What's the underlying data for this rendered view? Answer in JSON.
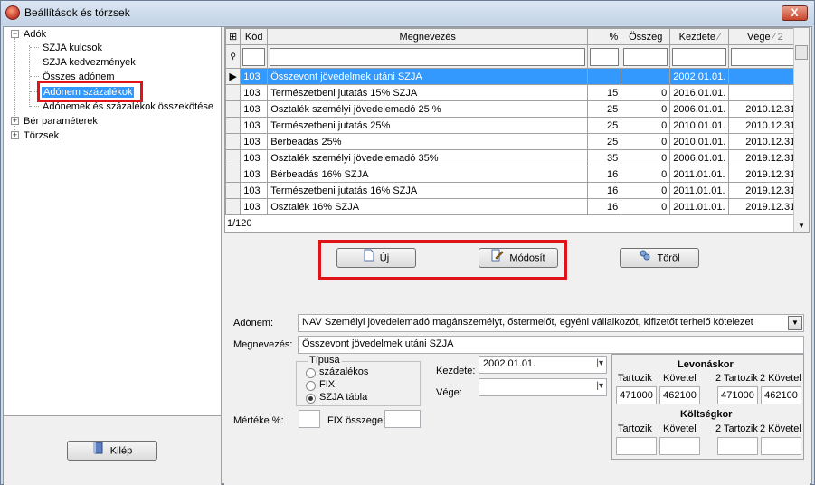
{
  "window": {
    "title": "Beállítások és törzsek",
    "close_label": "X"
  },
  "tree": {
    "root_adok": "Adók",
    "items": [
      "SZJA kulcsok",
      "SZJA kedvezmények",
      "Összes adónem",
      "Adónem százalékok",
      "Adónemek és százalékok összekötése"
    ],
    "ber_parameterek": "Bér paraméterek",
    "torzsek": "Törzsek"
  },
  "exit_button": "Kilép",
  "grid": {
    "columns": [
      "Kód",
      "Megnevezés",
      "%",
      "Összeg",
      "Kezdete",
      "Vége"
    ],
    "vege_sort_marker": "2",
    "rows": [
      {
        "kod": "103",
        "nev": "Összevont jövedelmek utáni SZJA",
        "pct": "",
        "osszeg": "",
        "kezdete": "2002.01.01.",
        "vege": ""
      },
      {
        "kod": "103",
        "nev": "Természetbeni jutatás 15% SZJA",
        "pct": "15",
        "osszeg": "0",
        "kezdete": "2016.01.01.",
        "vege": ""
      },
      {
        "kod": "103",
        "nev": "Osztalék személyi jövedelemadó 25 %",
        "pct": "25",
        "osszeg": "0",
        "kezdete": "2006.01.01.",
        "vege": "2010.12.31."
      },
      {
        "kod": "103",
        "nev": "Természetbeni jutatás 25%",
        "pct": "25",
        "osszeg": "0",
        "kezdete": "2010.01.01.",
        "vege": "2010.12.31."
      },
      {
        "kod": "103",
        "nev": "Bérbeadás 25%",
        "pct": "25",
        "osszeg": "0",
        "kezdete": "2010.01.01.",
        "vege": "2010.12.31."
      },
      {
        "kod": "103",
        "nev": "Osztalék személyi jövedelemadó 35%",
        "pct": "35",
        "osszeg": "0",
        "kezdete": "2006.01.01.",
        "vege": "2019.12.31."
      },
      {
        "kod": "103",
        "nev": "Bérbeadás 16% SZJA",
        "pct": "16",
        "osszeg": "0",
        "kezdete": "2011.01.01.",
        "vege": "2019.12.31."
      },
      {
        "kod": "103",
        "nev": "Természetbeni jutatás 16% SZJA",
        "pct": "16",
        "osszeg": "0",
        "kezdete": "2011.01.01.",
        "vege": "2019.12.31."
      },
      {
        "kod": "103",
        "nev": "Osztalék 16% SZJA",
        "pct": "16",
        "osszeg": "0",
        "kezdete": "2011.01.01.",
        "vege": "2019.12.31."
      }
    ],
    "counter": "1/120"
  },
  "buttons": {
    "new": "Új",
    "modify": "Módosít",
    "delete": "Töröl"
  },
  "form": {
    "adonem_label": "Adónem:",
    "adonem_value": "NAV Személyi jövedelemadó magánszemélyt, őstermelőt, egyéni vállalkozót, kifizetőt terhelő kötelezet",
    "megnevezes_label": "Megnevezés:",
    "megnevezes_value": "Összevont jövedelmek utáni SZJA",
    "tipusa_label": "Típusa",
    "types": [
      "százalékos",
      "FIX",
      "SZJA tábla"
    ],
    "kezdete_label": "Kezdete:",
    "kezdete_value": "2002.01.01.",
    "vege_label": "Vége:",
    "merteke_label": "Mértéke %:",
    "fix_label": "FIX összege:"
  },
  "accounts": {
    "levonaskor": "Levonáskor",
    "koltsegkor": "Költségkor",
    "col_labels": [
      "Tartozik",
      "Követel",
      "2 Tartozik",
      "2 Követel"
    ],
    "levonaskor_values": [
      "471000",
      "462100",
      "471000",
      "462100"
    ]
  }
}
